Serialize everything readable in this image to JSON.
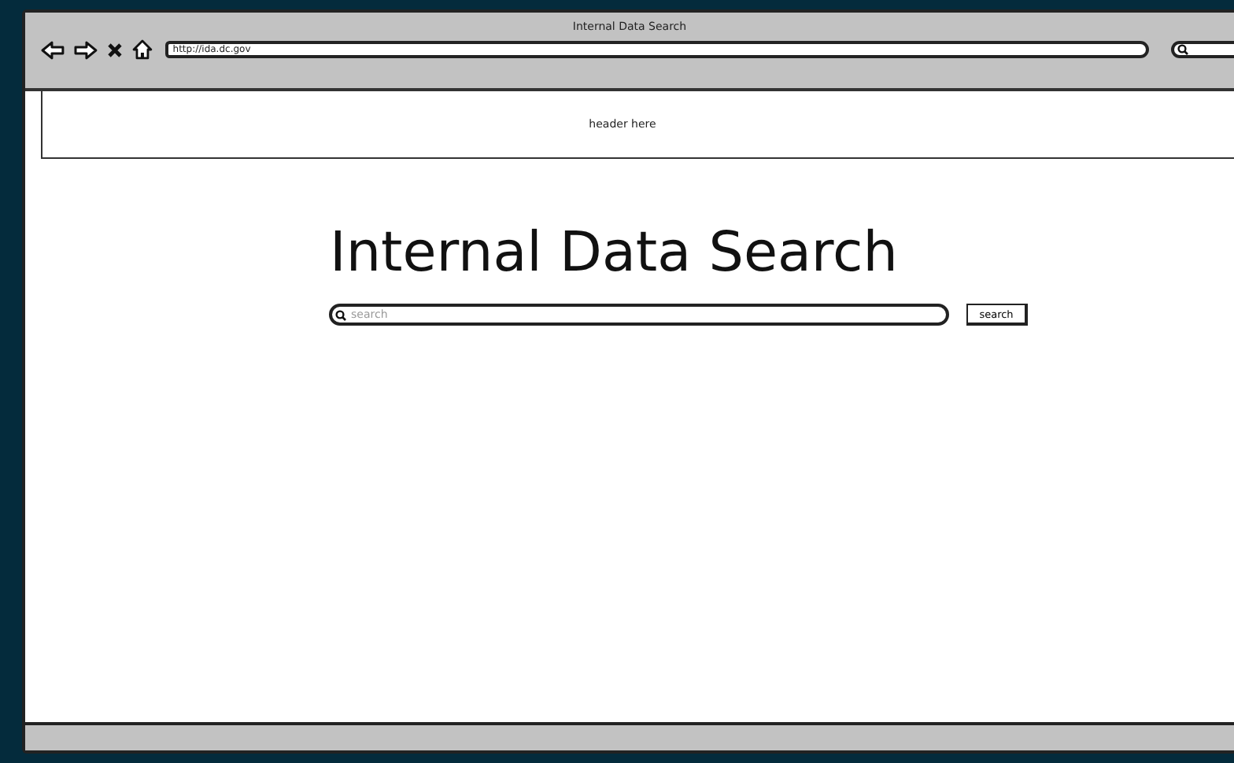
{
  "window": {
    "title": "Internal Data Search"
  },
  "address_bar": {
    "url": "http://ida.dc.gov"
  },
  "header": {
    "text": "header here"
  },
  "page": {
    "heading": "Internal Data Search"
  },
  "search": {
    "placeholder": "search",
    "button": "search"
  }
}
